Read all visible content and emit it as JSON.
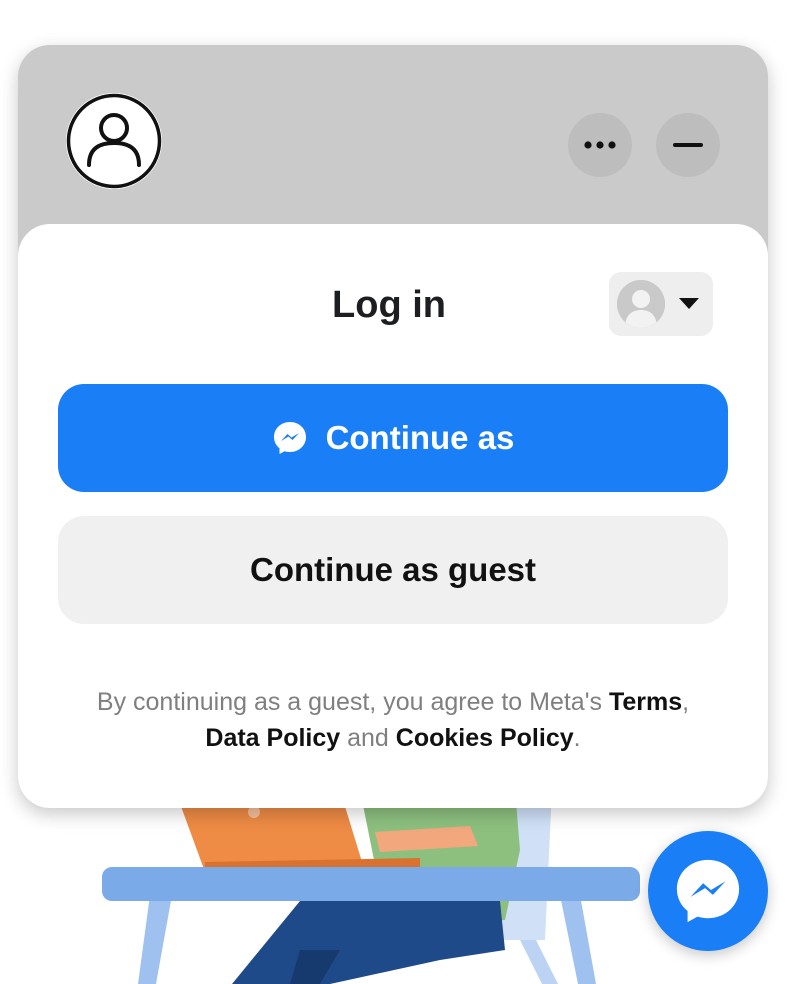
{
  "colors": {
    "header_bg": "#cacaca",
    "primary": "#1a7ff7",
    "secondary_bg": "#f0f0f0",
    "legal_text": "#7f7f7f",
    "link_text": "#111111"
  },
  "header": {
    "avatar_icon": "user-outline-icon",
    "more_icon": "more-horizontal-icon",
    "minimize_icon": "minimize-icon"
  },
  "login": {
    "title": "Log in",
    "account_switcher_icon": "default-avatar-icon",
    "caret_icon": "caret-down-icon",
    "continue_button": {
      "icon": "messenger-icon",
      "label": "Continue as"
    },
    "guest_button": {
      "label": "Continue as guest"
    },
    "legal": {
      "prefix": "By continuing as a guest, you agree to Meta's ",
      "terms": "Terms",
      "comma": ",",
      "data_policy": "Data Policy",
      "and": " and ",
      "cookies_policy": "Cookies Policy",
      "period": "."
    }
  },
  "fab": {
    "icon": "messenger-icon"
  }
}
